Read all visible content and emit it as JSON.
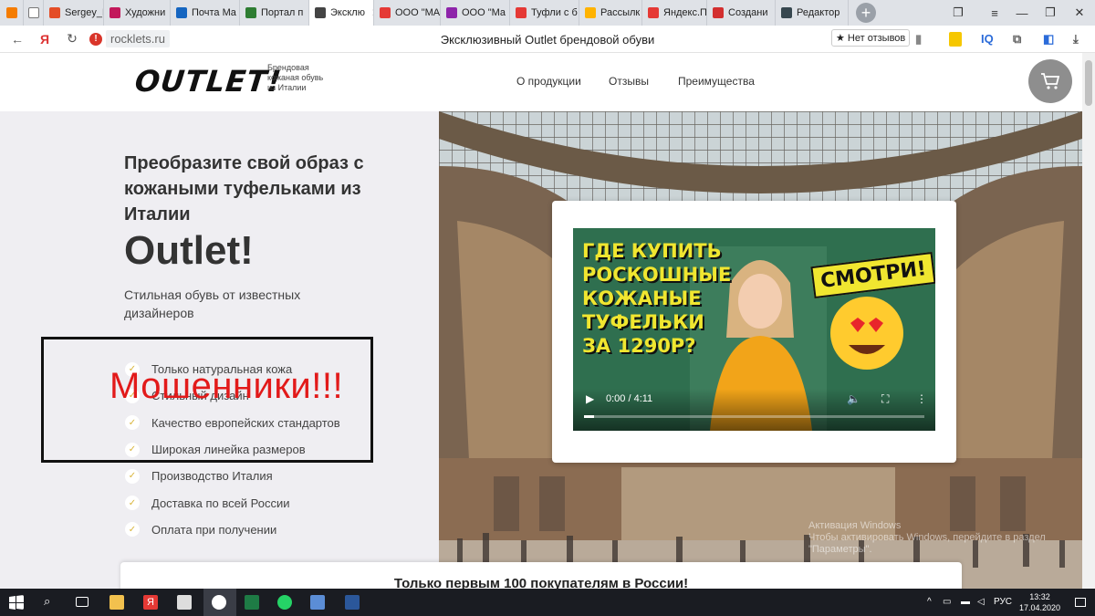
{
  "browser": {
    "tabs": [
      {
        "label": "Sergey_D",
        "color": "#e44d26"
      },
      {
        "label": "Художни",
        "color": "#c2185b"
      },
      {
        "label": "Почта Ma",
        "color": "#1565c0"
      },
      {
        "label": "Портал п",
        "color": "#2e7d32"
      },
      {
        "label": "Эксклю",
        "color": "#444444"
      },
      {
        "label": "ООО \"МА",
        "color": "#e53935"
      },
      {
        "label": "ООО \"Ма",
        "color": "#8e24aa"
      },
      {
        "label": "Туфли с б",
        "color": "#e53935"
      },
      {
        "label": "Рассылк",
        "color": "#ffb300"
      },
      {
        "label": "Яндекс.П",
        "color": "#e53935"
      },
      {
        "label": "Создани",
        "color": "#d32f2f"
      },
      {
        "label": "Редактор",
        "color": "#37474f"
      }
    ],
    "new_tab": "+",
    "url": "rocklets.ru",
    "page_title": "Эксклюзивный Outlet брендовой обуви",
    "reviews": "★ Нет отзывов",
    "ext_iq": "IQ"
  },
  "site": {
    "logo": "OUTLET!",
    "tagline": "Брендовая кожаная обувь из Италии",
    "nav": [
      "О продукции",
      "Отзывы",
      "Преимущества"
    ],
    "headline": "Преобразите свой образ с кожаными туфельками из Италии",
    "brand": "Outlet!",
    "subtitle": "Стильная обувь от известных дизайнеров",
    "features": [
      "Только натуральная кожа",
      "Стильный дизайн",
      "Качество европейских стандартов",
      "Широкая линейка размеров",
      "Производство Италия",
      "Доставка по всей России",
      "Оплата при получении"
    ],
    "annotation": "Мошенники!!!",
    "promo": "Только первым 100 покупателям в России!"
  },
  "video": {
    "headline_lines": [
      "ГДЕ КУПИТЬ",
      "РОСКОШНЫЕ",
      "КОЖАНЫЕ",
      "ТУФЕЛЬКИ",
      "ЗА 1290Р?"
    ],
    "badge": "СМОТРИ!",
    "time": "0:00 / 4:11",
    "progress_fraction": 0.03
  },
  "watermark": {
    "line1": "Активация Windows",
    "line2": "Чтобы активировать Windows, перейдите в раздел",
    "line3": "\"Параметры\"."
  },
  "taskbar": {
    "lang": "РУС",
    "time": "13:32",
    "date": "17.04.2020"
  },
  "colors": {
    "accent_red": "#e21a1a",
    "cart_gray": "#8e8e8e",
    "hero_bg": "#efeef2"
  }
}
